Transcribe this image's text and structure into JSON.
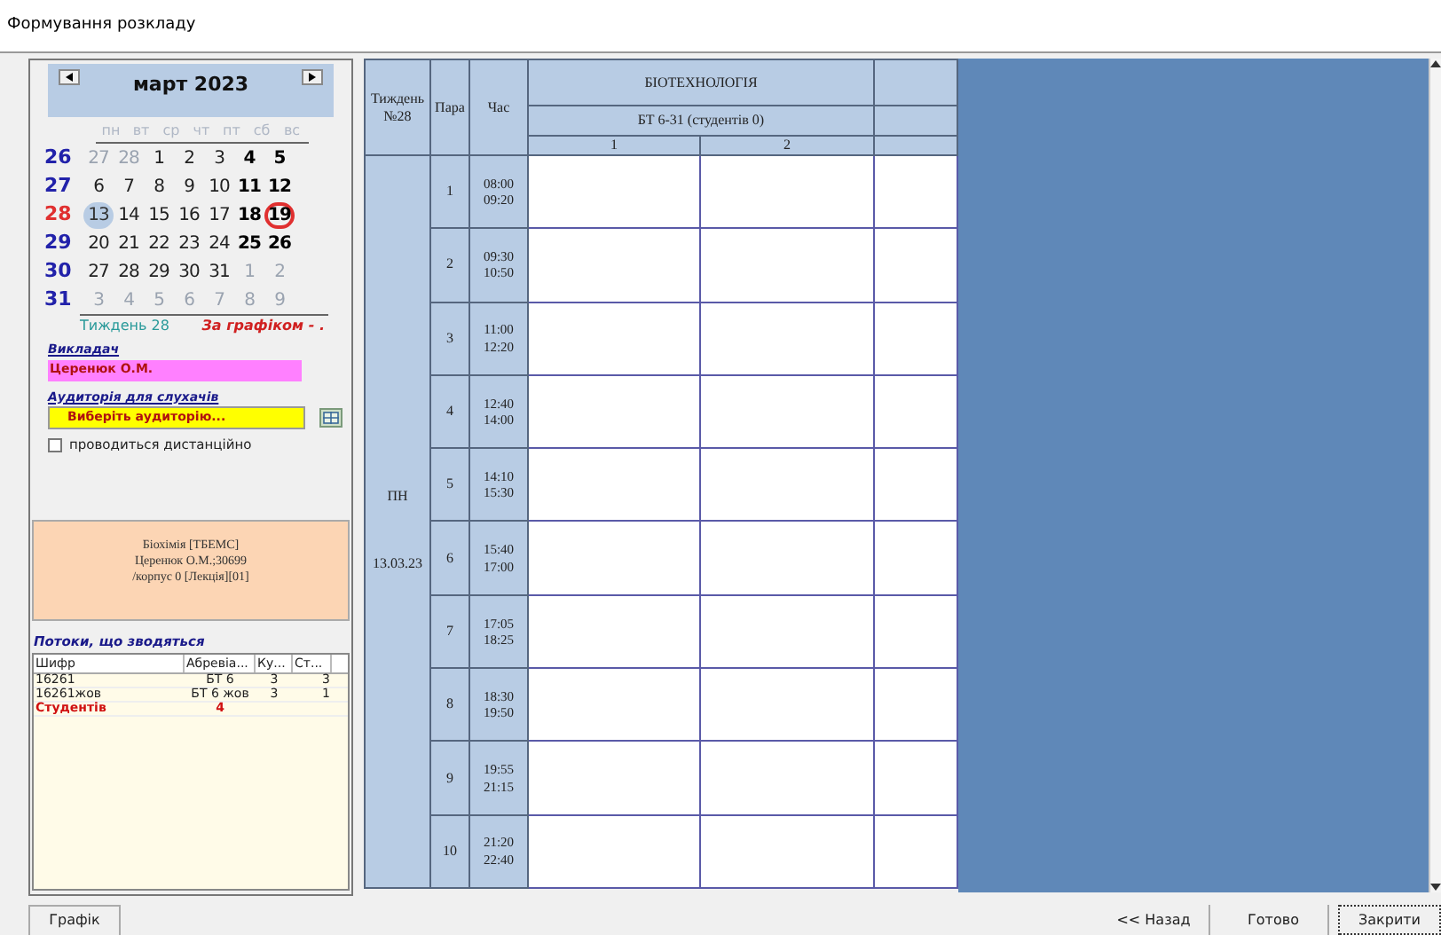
{
  "window": {
    "title": "Формування розкладу"
  },
  "calendar": {
    "month": "март 2023",
    "weekdays": [
      "пн",
      "вт",
      "ср",
      "чт",
      "пт",
      "сб",
      "вс"
    ],
    "weeks": [
      {
        "number": "26",
        "current": false,
        "days": [
          {
            "text": "27",
            "kind": "other"
          },
          {
            "text": "28",
            "kind": "other"
          },
          {
            "text": "1",
            "kind": "normal"
          },
          {
            "text": "2",
            "kind": "normal"
          },
          {
            "text": "3",
            "kind": "normal"
          },
          {
            "text": "4",
            "kind": "weekend"
          },
          {
            "text": "5",
            "kind": "weekend"
          }
        ]
      },
      {
        "number": "27",
        "current": false,
        "days": [
          {
            "text": "6",
            "kind": "normal"
          },
          {
            "text": "7",
            "kind": "normal"
          },
          {
            "text": "8",
            "kind": "normal"
          },
          {
            "text": "9",
            "kind": "normal"
          },
          {
            "text": "10",
            "kind": "normal"
          },
          {
            "text": "11",
            "kind": "weekend"
          },
          {
            "text": "12",
            "kind": "weekend"
          }
        ]
      },
      {
        "number": "28",
        "current": true,
        "days": [
          {
            "text": "13",
            "kind": "selected"
          },
          {
            "text": "14",
            "kind": "normal"
          },
          {
            "text": "15",
            "kind": "normal"
          },
          {
            "text": "16",
            "kind": "normal"
          },
          {
            "text": "17",
            "kind": "normal"
          },
          {
            "text": "18",
            "kind": "weekend"
          },
          {
            "text": "19",
            "kind": "today"
          }
        ]
      },
      {
        "number": "29",
        "current": false,
        "days": [
          {
            "text": "20",
            "kind": "normal"
          },
          {
            "text": "21",
            "kind": "normal"
          },
          {
            "text": "22",
            "kind": "normal"
          },
          {
            "text": "23",
            "kind": "normal"
          },
          {
            "text": "24",
            "kind": "normal"
          },
          {
            "text": "25",
            "kind": "weekend"
          },
          {
            "text": "26",
            "kind": "weekend"
          }
        ]
      },
      {
        "number": "30",
        "current": false,
        "days": [
          {
            "text": "27",
            "kind": "normal"
          },
          {
            "text": "28",
            "kind": "normal"
          },
          {
            "text": "29",
            "kind": "normal"
          },
          {
            "text": "30",
            "kind": "normal"
          },
          {
            "text": "31",
            "kind": "normal"
          },
          {
            "text": "1",
            "kind": "other"
          },
          {
            "text": "2",
            "kind": "other"
          }
        ]
      },
      {
        "number": "31",
        "current": false,
        "days": [
          {
            "text": "3",
            "kind": "other"
          },
          {
            "text": "4",
            "kind": "other"
          },
          {
            "text": "5",
            "kind": "other"
          },
          {
            "text": "6",
            "kind": "other"
          },
          {
            "text": "7",
            "kind": "other"
          },
          {
            "text": "8",
            "kind": "other"
          },
          {
            "text": "9",
            "kind": "other"
          }
        ]
      }
    ],
    "week_label": "Тиждень 28",
    "schedule_label": "За графіком - ."
  },
  "teacher": {
    "label": "Викладач",
    "value": "Церенюк О.М."
  },
  "auditorium": {
    "label": "Аудиторія для слухачів",
    "value": "Виберіть аудиторію..."
  },
  "remote": {
    "label": "проводиться дистанційно",
    "checked": false
  },
  "lesson_info": [
    "Біохімія [ТБЕМС]",
    "Церенюк О.М.;30699",
    "/корпус 0 [Лекція][01]"
  ],
  "streams": {
    "title": "Потоки, що зводяться",
    "columns": [
      "Шифр",
      "Абревіа...",
      "Ку...",
      "Ст..."
    ],
    "rows": [
      {
        "kind": "stream",
        "cells": [
          "16261",
          "БТ 6",
          "3",
          "3"
        ]
      },
      {
        "kind": "stream",
        "cells": [
          "16261жов",
          "БТ 6 жов",
          "3",
          "1"
        ]
      },
      {
        "kind": "total",
        "cells": [
          "Студентів",
          "4",
          "",
          ""
        ]
      }
    ]
  },
  "schedule": {
    "week": "Тиждень №28",
    "pair": "Пара",
    "time": "Час",
    "faculty": "БІОТЕХНОЛОГІЯ",
    "group": "БТ 6-31  (студентів 0)",
    "subgroups": [
      "1",
      "2"
    ],
    "day": {
      "name": "ПН",
      "date": "13.03.23"
    },
    "pairs": [
      {
        "number": "1",
        "start": "08:00",
        "end": "09:20"
      },
      {
        "number": "2",
        "start": "09:30",
        "end": "10:50"
      },
      {
        "number": "3",
        "start": "11:00",
        "end": "12:20"
      },
      {
        "number": "4",
        "start": "12:40",
        "end": "14:00"
      },
      {
        "number": "5",
        "start": "14:10",
        "end": "15:30"
      },
      {
        "number": "6",
        "start": "15:40",
        "end": "17:00"
      },
      {
        "number": "7",
        "start": "17:05",
        "end": "18:25"
      },
      {
        "number": "8",
        "start": "18:30",
        "end": "19:50"
      },
      {
        "number": "9",
        "start": "19:55",
        "end": "21:15"
      },
      {
        "number": "10",
        "start": "21:20",
        "end": "22:40"
      }
    ]
  },
  "buttons": {
    "chart": "Графік",
    "back": "<< Назад",
    "done": "Готово",
    "close": "Закрити"
  }
}
